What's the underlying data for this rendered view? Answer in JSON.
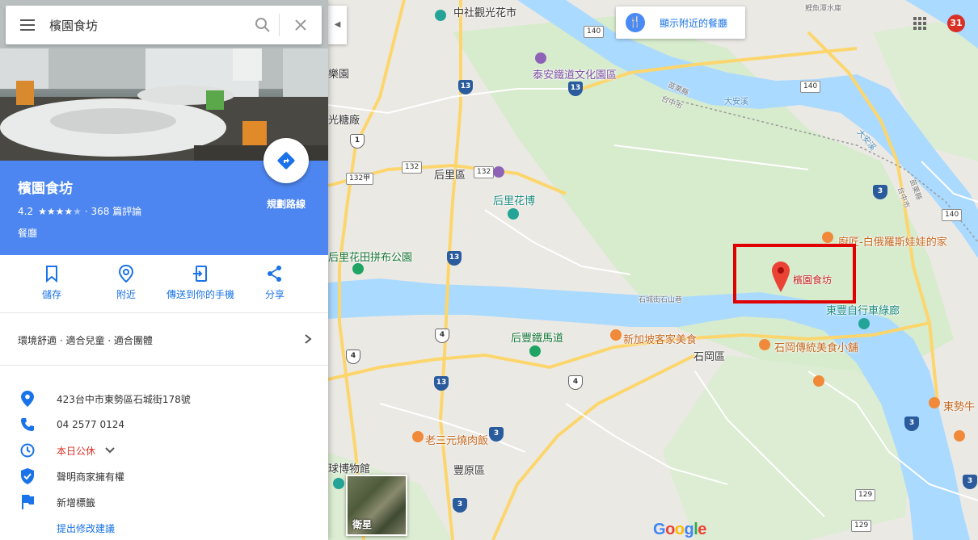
{
  "search": {
    "value": "檳園食坊"
  },
  "place": {
    "name": "檳園食坊",
    "rating": "4.2",
    "reviews": "· 368 篇評論",
    "category": "餐廳",
    "route_label": "規劃路線"
  },
  "actions": [
    {
      "label": "儲存",
      "icon": "bookmark-icon"
    },
    {
      "label": "附近",
      "icon": "nearby-icon"
    },
    {
      "label": "傳送到你的手機",
      "icon": "send-to-phone-icon"
    },
    {
      "label": "分享",
      "icon": "share-icon"
    }
  ],
  "attributes": "環境舒適 · 適合兒童 · 適合團體",
  "info": {
    "address": "423台中市東勢區石城街178號",
    "phone": "04 2577 0124",
    "hours": "本日公休",
    "claim": "聲明商家擁有權",
    "add_label": "新增標籤",
    "suggest_edit": "提出修改建議"
  },
  "map": {
    "food_button": "顯示附近的餐廳",
    "satellite_label": "衛星",
    "avatar_count": "31",
    "google_logo": "Google",
    "marker_label": "檳園食坊",
    "colors": {
      "water": "#aadaff",
      "land": "#ebe9e4",
      "green": "#d6ebcb",
      "road": "#fcd66d",
      "accent": "#4d86f0",
      "marker": "#ea4335"
    },
    "labels": {
      "zhongshe": "中社觀光花市",
      "taian": "泰安鐵道文化園區",
      "houli": "后里區",
      "houli_flower": "后里花博",
      "paradise": "樂園",
      "sugar": "光糖廠",
      "quilt_park": "后里花田拼布公園",
      "houfeng": "后豐鐵馬道",
      "singapore": "新加坡客家美食",
      "shigang": "石岡區",
      "shigang_food": "石岡傳統美食小舖",
      "chef": "廚匠-白俄羅斯娃娃的家",
      "bikeway": "東豐自行車綠廊",
      "dongshi_cow": "東勢牛",
      "fengyuan": "豐原區",
      "laosan": "老三元燒肉飯",
      "ball_museum": "球博物館",
      "daan_river": "大安溪",
      "daan_river2": "大安溪",
      "miaoli": "苗栗縣",
      "taichung": "台中市",
      "miaoli2": "苗栗縣",
      "taichung2": "台中市",
      "liyu": "鯉魚潭水庫",
      "shicheng": "石城街石山巷"
    },
    "shields": [
      "140",
      "140",
      "140",
      "132",
      "132",
      "132甲",
      "129",
      "129"
    ],
    "highways": [
      "13",
      "13",
      "13",
      "13",
      "3",
      "3",
      "3",
      "3",
      "1",
      "4",
      "4",
      "4",
      "3"
    ]
  }
}
